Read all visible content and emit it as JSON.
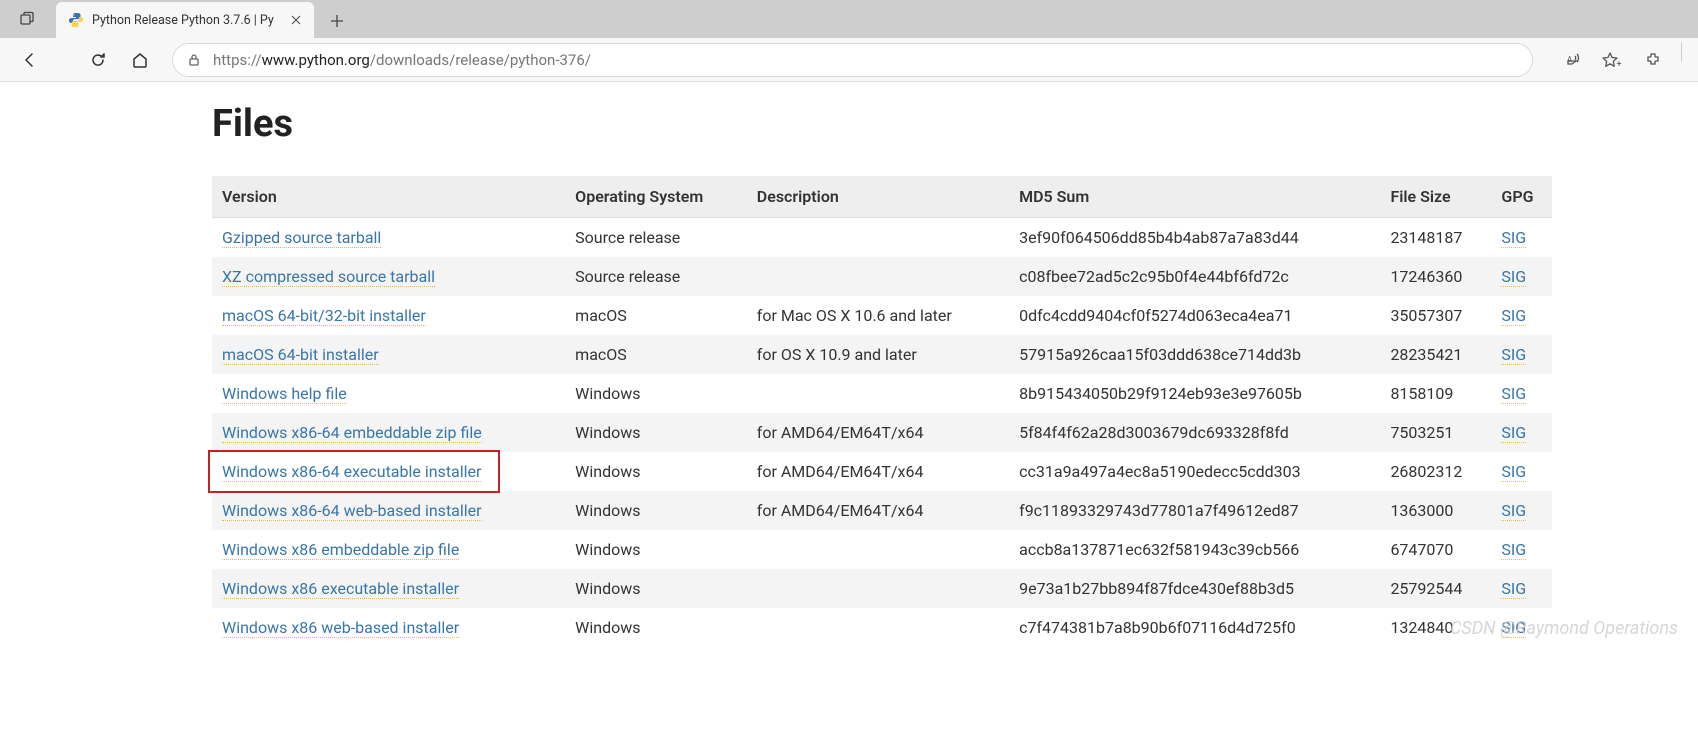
{
  "browser": {
    "tab_title": "Python Release Python 3.7.6 | Py",
    "url_prefix": "https://",
    "url_host": "www.python.org",
    "url_path": "/downloads/release/python-376/"
  },
  "page": {
    "heading": "Files",
    "watermark": "CSDN @Raymond Operations"
  },
  "table": {
    "headers": {
      "version": "Version",
      "os": "Operating System",
      "desc": "Description",
      "md5": "MD5 Sum",
      "size": "File Size",
      "gpg": "GPG"
    },
    "rows": [
      {
        "version": "Gzipped source tarball",
        "os": "Source release",
        "desc": "",
        "md5": "3ef90f064506dd85b4b4ab87a7a83d44",
        "size": "23148187",
        "gpg": "SIG",
        "hl": false
      },
      {
        "version": "XZ compressed source tarball",
        "os": "Source release",
        "desc": "",
        "md5": "c08fbee72ad5c2c95b0f4e44bf6fd72c",
        "size": "17246360",
        "gpg": "SIG",
        "hl": false
      },
      {
        "version": "macOS 64-bit/32-bit installer",
        "os": "macOS",
        "desc": "for Mac OS X 10.6 and later",
        "md5": "0dfc4cdd9404cf0f5274d063eca4ea71",
        "size": "35057307",
        "gpg": "SIG",
        "hl": false
      },
      {
        "version": "macOS 64-bit installer",
        "os": "macOS",
        "desc": "for OS X 10.9 and later",
        "md5": "57915a926caa15f03ddd638ce714dd3b",
        "size": "28235421",
        "gpg": "SIG",
        "hl": false
      },
      {
        "version": "Windows help file",
        "os": "Windows",
        "desc": "",
        "md5": "8b915434050b29f9124eb93e3e97605b",
        "size": "8158109",
        "gpg": "SIG",
        "hl": false
      },
      {
        "version": "Windows x86-64 embeddable zip file",
        "os": "Windows",
        "desc": "for AMD64/EM64T/x64",
        "md5": "5f84f4f62a28d3003679dc693328f8fd",
        "size": "7503251",
        "gpg": "SIG",
        "hl": false
      },
      {
        "version": "Windows x86-64 executable installer",
        "os": "Windows",
        "desc": "for AMD64/EM64T/x64",
        "md5": "cc31a9a497a4ec8a5190edecc5cdd303",
        "size": "26802312",
        "gpg": "SIG",
        "hl": true
      },
      {
        "version": "Windows x86-64 web-based installer",
        "os": "Windows",
        "desc": "for AMD64/EM64T/x64",
        "md5": "f9c11893329743d77801a7f49612ed87",
        "size": "1363000",
        "gpg": "SIG",
        "hl": false
      },
      {
        "version": "Windows x86 embeddable zip file",
        "os": "Windows",
        "desc": "",
        "md5": "accb8a137871ec632f581943c39cb566",
        "size": "6747070",
        "gpg": "SIG",
        "hl": false
      },
      {
        "version": "Windows x86 executable installer",
        "os": "Windows",
        "desc": "",
        "md5": "9e73a1b27bb894f87fdce430ef88b3d5",
        "size": "25792544",
        "gpg": "SIG",
        "hl": false
      },
      {
        "version": "Windows x86 web-based installer",
        "os": "Windows",
        "desc": "",
        "md5": "c7f474381b7a8b90b6f07116d4d725f0",
        "size": "1324840",
        "gpg": "SIG",
        "hl": false
      }
    ]
  }
}
